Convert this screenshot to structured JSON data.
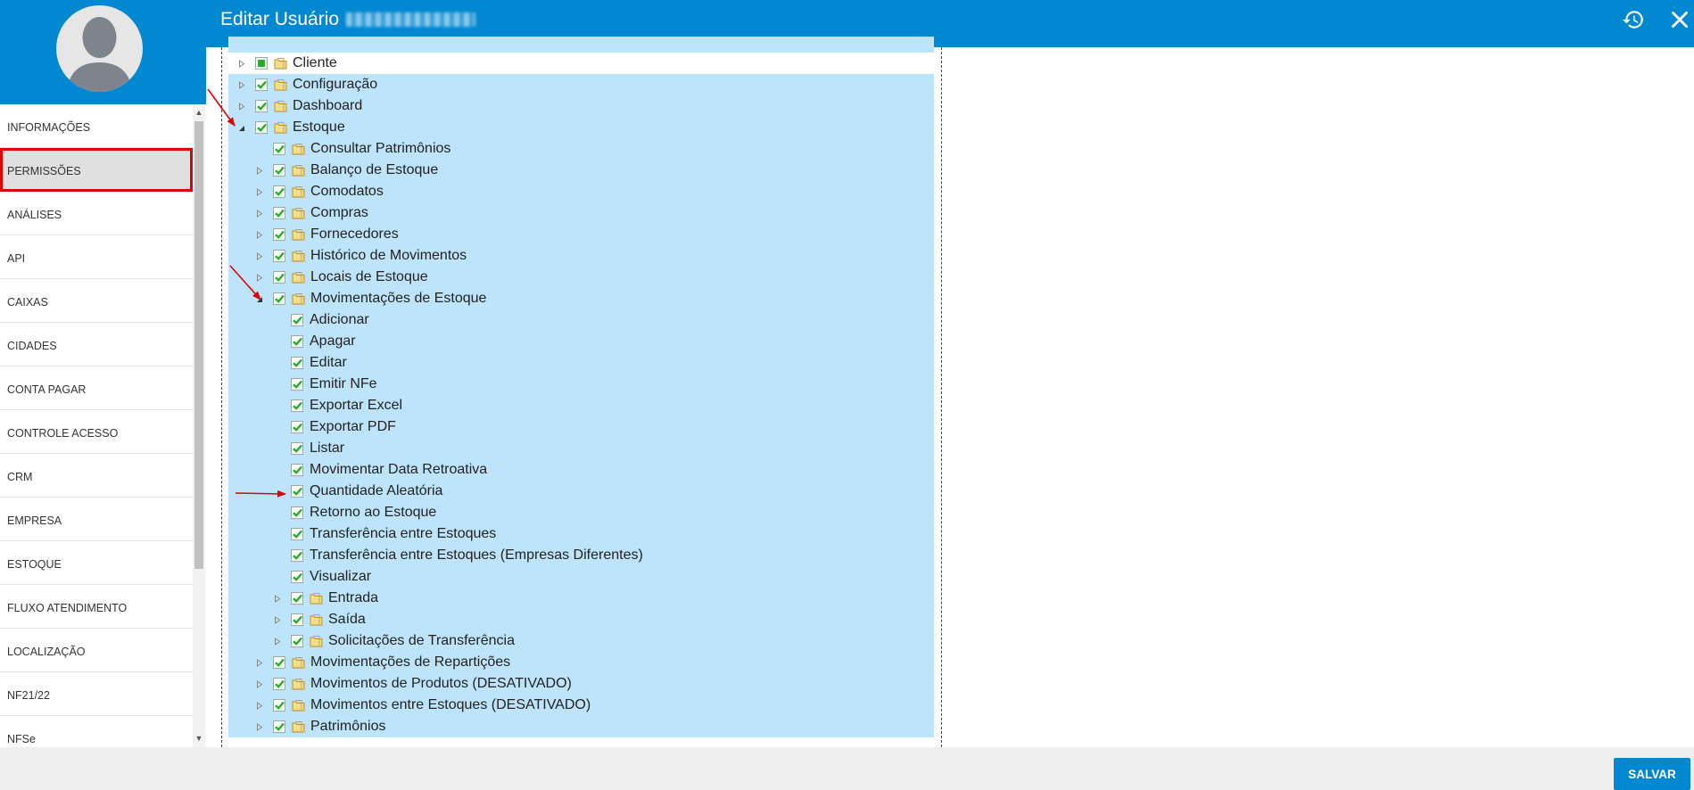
{
  "header": {
    "title": "Editar Usuário",
    "history_icon": "history-icon",
    "close_icon": "close-icon"
  },
  "sidebar": {
    "items": [
      {
        "label": "INFORMAÇÕES",
        "active": false
      },
      {
        "label": "PERMISSÕES",
        "active": true
      },
      {
        "label": "ANÁLISES",
        "active": false
      },
      {
        "label": "API",
        "active": false
      },
      {
        "label": "CAIXAS",
        "active": false
      },
      {
        "label": "CIDADES",
        "active": false
      },
      {
        "label": "CONTA PAGAR",
        "active": false
      },
      {
        "label": "CONTROLE ACESSO",
        "active": false
      },
      {
        "label": "CRM",
        "active": false
      },
      {
        "label": "EMPRESA",
        "active": false
      },
      {
        "label": "ESTOQUE",
        "active": false
      },
      {
        "label": "FLUXO ATENDIMENTO",
        "active": false
      },
      {
        "label": "LOCALIZAÇÃO",
        "active": false
      },
      {
        "label": "NF21/22",
        "active": false
      },
      {
        "label": "NFSe",
        "active": false
      }
    ]
  },
  "tree": {
    "rows": [
      {
        "label": "Cliente",
        "level": 0,
        "expander": "collapsed",
        "check": "partial",
        "folder": true,
        "highlight": false
      },
      {
        "label": "Configuração",
        "level": 0,
        "expander": "collapsed",
        "check": "checked",
        "folder": true,
        "highlight": true
      },
      {
        "label": "Dashboard",
        "level": 0,
        "expander": "collapsed",
        "check": "checked",
        "folder": true,
        "highlight": true
      },
      {
        "label": "Estoque",
        "level": 0,
        "expander": "expanded",
        "check": "checked",
        "folder": true,
        "highlight": true
      },
      {
        "label": "Consultar Patrimônios",
        "level": 1,
        "expander": "none",
        "check": "checked",
        "folder": true,
        "highlight": true
      },
      {
        "label": "Balanço de Estoque",
        "level": 1,
        "expander": "collapsed",
        "check": "checked",
        "folder": true,
        "highlight": true
      },
      {
        "label": "Comodatos",
        "level": 1,
        "expander": "collapsed",
        "check": "checked",
        "folder": true,
        "highlight": true
      },
      {
        "label": "Compras",
        "level": 1,
        "expander": "collapsed",
        "check": "checked",
        "folder": true,
        "highlight": true
      },
      {
        "label": "Fornecedores",
        "level": 1,
        "expander": "collapsed",
        "check": "checked",
        "folder": true,
        "highlight": true
      },
      {
        "label": "Histórico de Movimentos",
        "level": 1,
        "expander": "collapsed",
        "check": "checked",
        "folder": true,
        "highlight": true
      },
      {
        "label": "Locais de Estoque",
        "level": 1,
        "expander": "collapsed",
        "check": "checked",
        "folder": true,
        "highlight": true
      },
      {
        "label": "Movimentações de Estoque",
        "level": 1,
        "expander": "expanded",
        "check": "checked",
        "folder": true,
        "highlight": true
      },
      {
        "label": "Adicionar",
        "level": 2,
        "expander": "none",
        "check": "checked",
        "folder": false,
        "highlight": true
      },
      {
        "label": "Apagar",
        "level": 2,
        "expander": "none",
        "check": "checked",
        "folder": false,
        "highlight": true
      },
      {
        "label": "Editar",
        "level": 2,
        "expander": "none",
        "check": "checked",
        "folder": false,
        "highlight": true
      },
      {
        "label": "Emitir NFe",
        "level": 2,
        "expander": "none",
        "check": "checked",
        "folder": false,
        "highlight": true
      },
      {
        "label": "Exportar Excel",
        "level": 2,
        "expander": "none",
        "check": "checked",
        "folder": false,
        "highlight": true
      },
      {
        "label": "Exportar PDF",
        "level": 2,
        "expander": "none",
        "check": "checked",
        "folder": false,
        "highlight": true
      },
      {
        "label": "Listar",
        "level": 2,
        "expander": "none",
        "check": "checked",
        "folder": false,
        "highlight": true
      },
      {
        "label": "Movimentar Data Retroativa",
        "level": 2,
        "expander": "none",
        "check": "checked",
        "folder": false,
        "highlight": true
      },
      {
        "label": "Quantidade Aleatória",
        "level": 2,
        "expander": "none",
        "check": "checked",
        "folder": false,
        "highlight": true
      },
      {
        "label": "Retorno ao Estoque",
        "level": 2,
        "expander": "none",
        "check": "checked",
        "folder": false,
        "highlight": true
      },
      {
        "label": "Transferência entre Estoques",
        "level": 2,
        "expander": "none",
        "check": "checked",
        "folder": false,
        "highlight": true
      },
      {
        "label": "Transferência entre Estoques (Empresas Diferentes)",
        "level": 2,
        "expander": "none",
        "check": "checked",
        "folder": false,
        "highlight": true
      },
      {
        "label": "Visualizar",
        "level": 2,
        "expander": "none",
        "check": "checked",
        "folder": false,
        "highlight": true
      },
      {
        "label": "Entrada",
        "level": 2,
        "expander": "collapsed",
        "check": "checked",
        "folder": true,
        "highlight": true
      },
      {
        "label": "Saída",
        "level": 2,
        "expander": "collapsed",
        "check": "checked",
        "folder": true,
        "highlight": true
      },
      {
        "label": "Solicitações de Transferência",
        "level": 2,
        "expander": "collapsed",
        "check": "checked",
        "folder": true,
        "highlight": true
      },
      {
        "label": "Movimentações de Repartições",
        "level": 1,
        "expander": "collapsed",
        "check": "checked",
        "folder": true,
        "highlight": true
      },
      {
        "label": "Movimentos de Produtos (DESATIVADO)",
        "level": 1,
        "expander": "collapsed",
        "check": "checked",
        "folder": true,
        "highlight": true
      },
      {
        "label": "Movimentos entre Estoques (DESATIVADO)",
        "level": 1,
        "expander": "collapsed",
        "check": "checked",
        "folder": true,
        "highlight": true
      },
      {
        "label": "Patrimônios",
        "level": 1,
        "expander": "collapsed",
        "check": "checked",
        "folder": true,
        "highlight": true
      }
    ]
  },
  "footer": {
    "save_label": "SALVAR"
  },
  "colors": {
    "brand": "#0288d1",
    "row_highlight": "#bde4fb",
    "check_green": "#2eaa2e",
    "annotation_red": "#e00000"
  }
}
